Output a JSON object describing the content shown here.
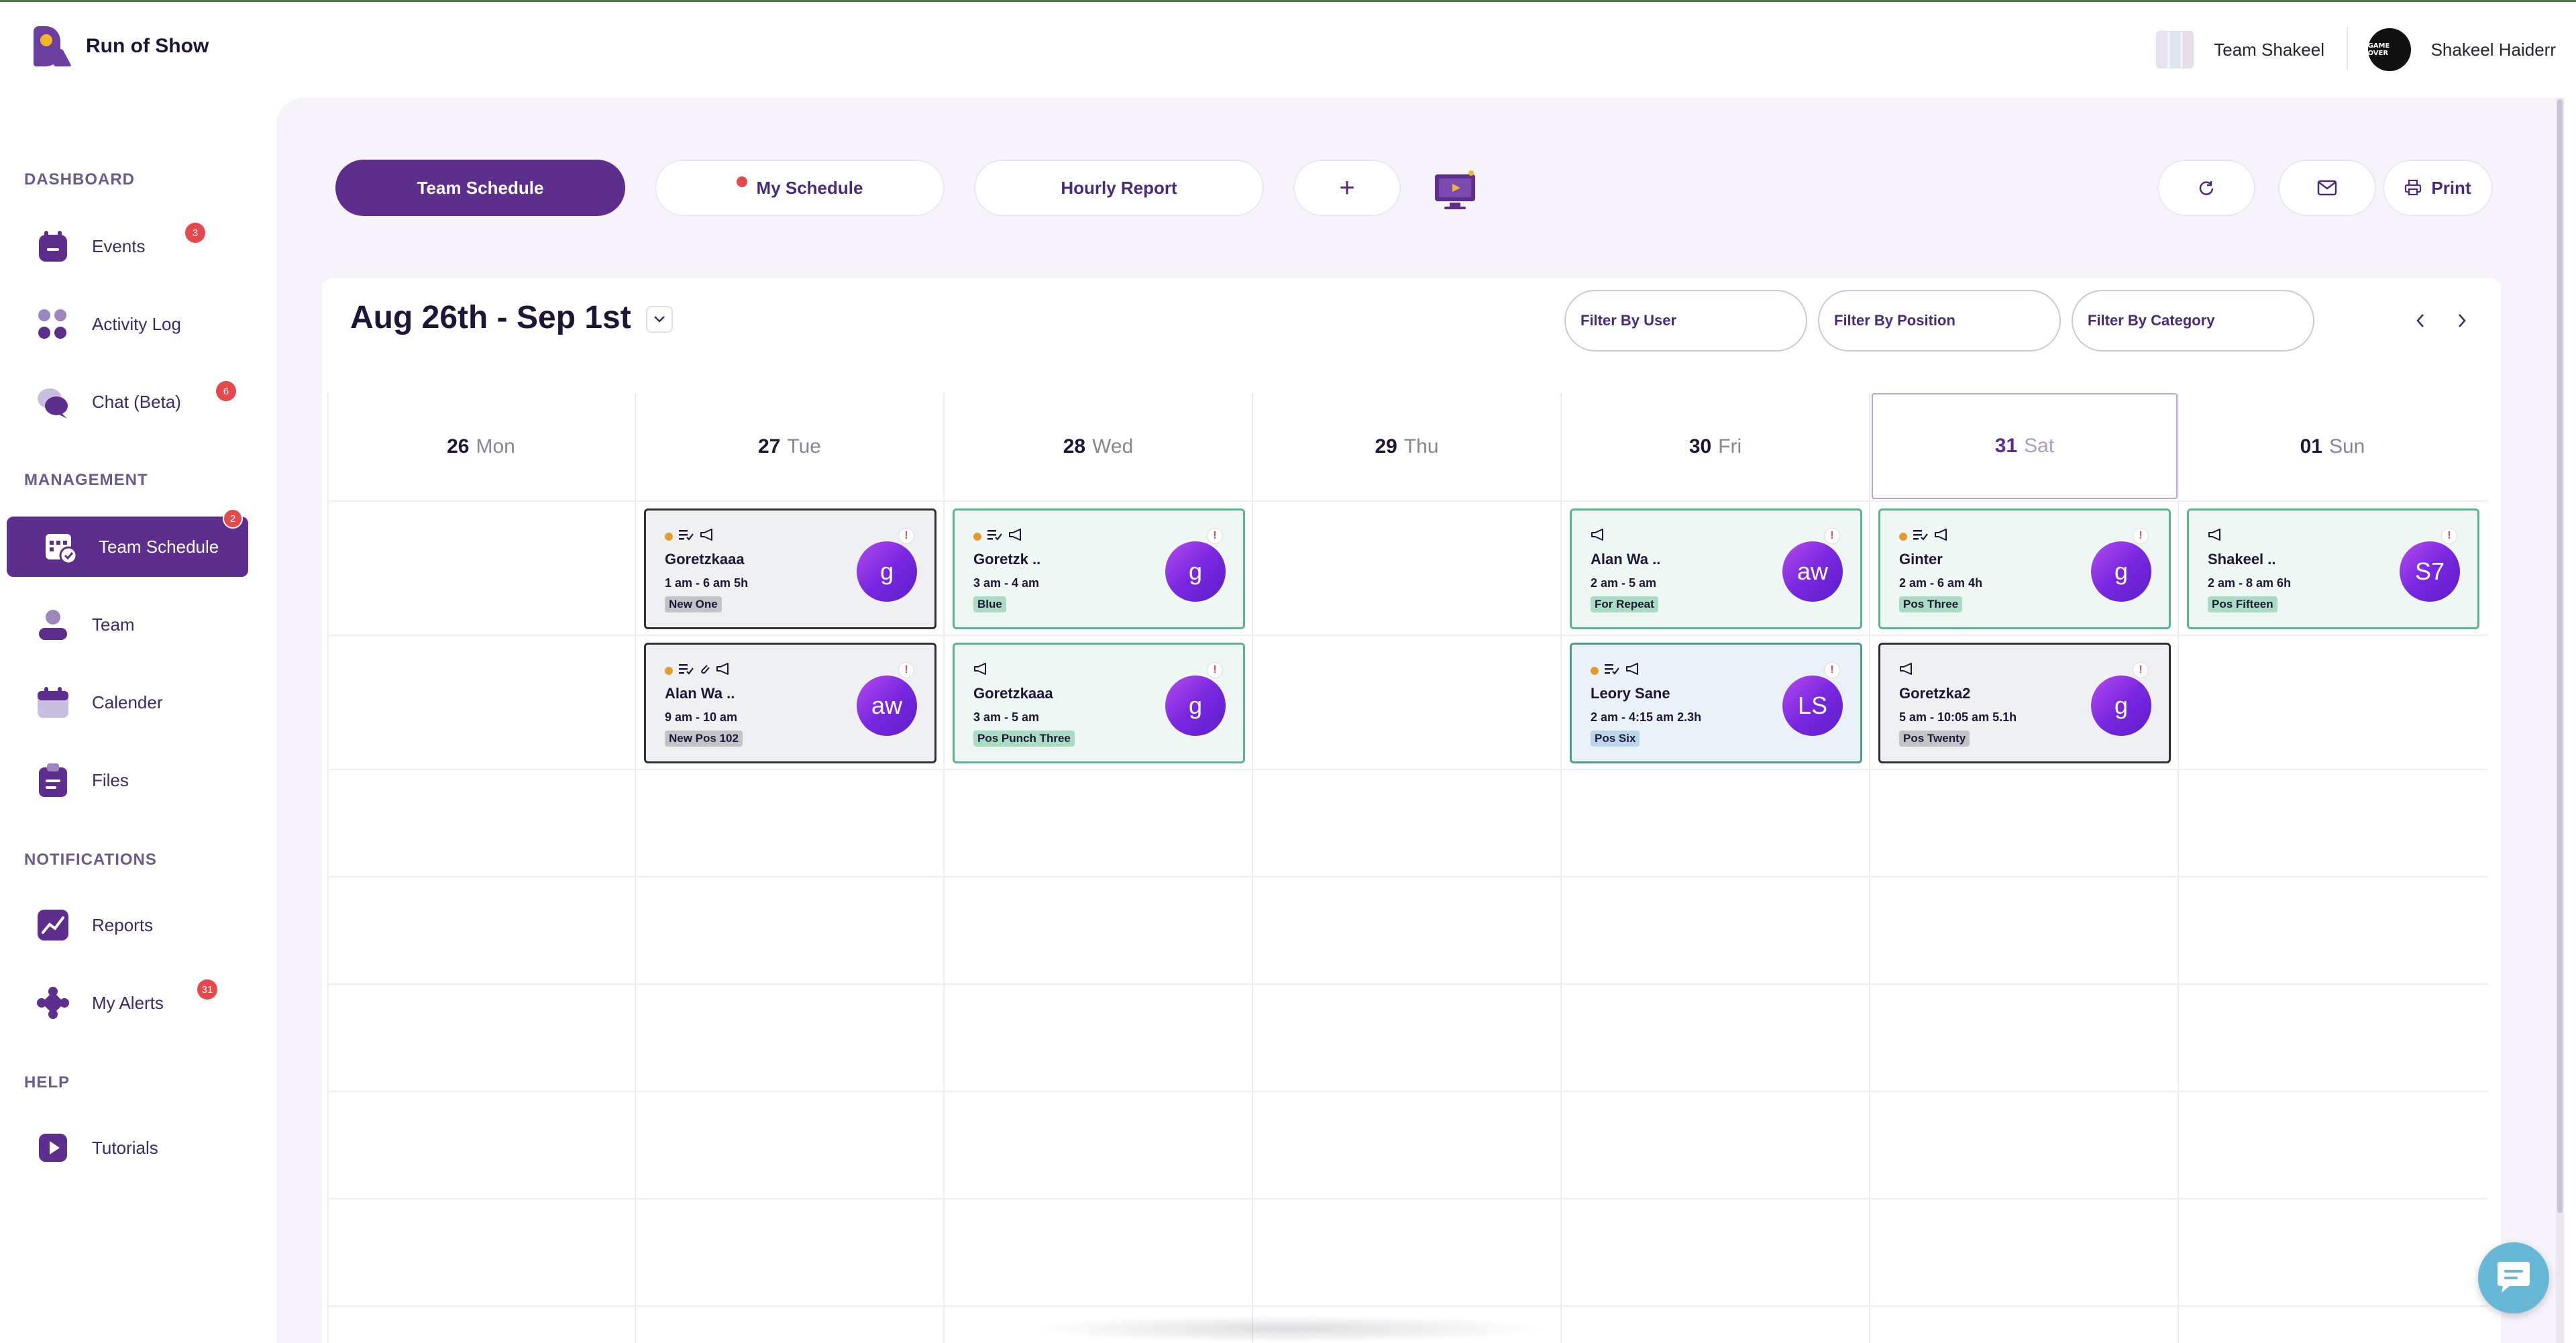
{
  "app": {
    "name": "Run of Show"
  },
  "header": {
    "team_name": "Team Shakeel",
    "user_name": "Shakeel Haiderr",
    "user_avatar_text": "GAME OVER"
  },
  "sidebar": {
    "sections": [
      "DASHBOARD",
      "MANAGEMENT",
      "NOTIFICATIONS",
      "HELP"
    ],
    "items": [
      {
        "label": "Events",
        "icon": "calendar-bag-icon",
        "badge": "3"
      },
      {
        "label": "Activity Log",
        "icon": "dots-cluster-icon",
        "badge": ""
      },
      {
        "label": "Chat (Beta)",
        "icon": "chat-bubbles-icon",
        "badge": "6"
      },
      {
        "label": "Team Schedule",
        "icon": "schedule-calendar-icon",
        "badge": "2",
        "active": true
      },
      {
        "label": "Team",
        "icon": "person-icon",
        "badge": ""
      },
      {
        "label": "Calender",
        "icon": "calendar-icon",
        "badge": ""
      },
      {
        "label": "Files",
        "icon": "clipboard-icon",
        "badge": ""
      },
      {
        "label": "Reports",
        "icon": "trend-chart-icon",
        "badge": ""
      },
      {
        "label": "My Alerts",
        "icon": "alert-diamond-icon",
        "badge": "31"
      },
      {
        "label": "Tutorials",
        "icon": "play-icon",
        "badge": ""
      }
    ]
  },
  "toolbar": {
    "tabs": [
      {
        "label": "Team Schedule",
        "active": true
      },
      {
        "label": "My Schedule",
        "active": false,
        "dot": true
      },
      {
        "label": "Hourly Report",
        "active": false
      }
    ],
    "add_label": "+",
    "print_label": "Print"
  },
  "calendar": {
    "range_title": "Aug 26th - Sep 1st",
    "filters": [
      "Filter By User",
      "Filter By Position",
      "Filter By Category"
    ],
    "days": [
      {
        "num": "26",
        "dow": "Mon",
        "today": false
      },
      {
        "num": "27",
        "dow": "Tue",
        "today": false
      },
      {
        "num": "28",
        "dow": "Wed",
        "today": false
      },
      {
        "num": "29",
        "dow": "Thu",
        "today": false
      },
      {
        "num": "30",
        "dow": "Fri",
        "today": false
      },
      {
        "num": "31",
        "dow": "Sat",
        "today": true
      },
      {
        "num": "01",
        "dow": "Sun",
        "today": false
      }
    ],
    "shifts": [
      {
        "day": 1,
        "row": 0,
        "style": "dark",
        "dot": true,
        "icons": "notes-megaphone",
        "name": "Goretzkaaa",
        "time": "1 am - 6 am 5h",
        "position": "New One",
        "avatar": "g"
      },
      {
        "day": 1,
        "row": 1,
        "style": "dark",
        "dot": true,
        "icons": "notes-clip-megaphone",
        "name": "Alan Wa ..",
        "time": "9 am - 10 am",
        "position": "New Pos 102",
        "avatar": "aw"
      },
      {
        "day": 2,
        "row": 0,
        "style": "green",
        "dot": true,
        "icons": "notes-megaphone",
        "name": "Goretzk ..",
        "time": "3 am - 4 am",
        "position": "Blue",
        "avatar": "g"
      },
      {
        "day": 2,
        "row": 1,
        "style": "green",
        "dot": false,
        "icons": "megaphone",
        "name": "Goretzkaaa",
        "time": "3 am - 5 am",
        "position": "Pos Punch Three",
        "avatar": "g"
      },
      {
        "day": 4,
        "row": 0,
        "style": "green",
        "dot": false,
        "icons": "megaphone",
        "name": "Alan Wa ..",
        "time": "2 am - 5 am",
        "position": "For Repeat",
        "avatar": "aw"
      },
      {
        "day": 4,
        "row": 1,
        "style": "blue",
        "dot": true,
        "icons": "notes-megaphone",
        "name": "Leory Sane",
        "time": "2 am - 4:15 am 2.3h",
        "position": "Pos Six",
        "avatar": "LS"
      },
      {
        "day": 5,
        "row": 0,
        "style": "green",
        "dot": true,
        "icons": "notes-megaphone",
        "name": "Ginter",
        "time": "2 am - 6 am 4h",
        "position": "Pos Three",
        "avatar": "g"
      },
      {
        "day": 5,
        "row": 1,
        "style": "dark",
        "dot": false,
        "icons": "megaphone",
        "name": "Goretzka2",
        "time": "5 am - 10:05 am 5.1h",
        "position": "Pos Twenty",
        "avatar": "g"
      },
      {
        "day": 6,
        "row": 0,
        "style": "green",
        "dot": false,
        "icons": "megaphone",
        "name": "Shakeel ..",
        "time": "2 am - 8 am 6h",
        "position": "Pos Fifteen",
        "avatar": "S7"
      }
    ]
  },
  "colors": {
    "brand": "#5d2e8e",
    "badge": "#e4494c",
    "panel": "#f7f3fa"
  }
}
